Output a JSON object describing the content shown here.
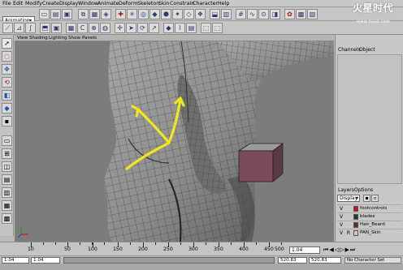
{
  "menubar": {
    "items": [
      "File",
      "Edit",
      "Modify",
      "Create",
      "Display",
      "Window",
      "Animate",
      "Deform",
      "Skeleton",
      "Skin",
      "Constrain",
      "Character",
      "Help"
    ]
  },
  "shelf": {
    "mode": "Animation"
  },
  "viewport": {
    "menu": [
      "View",
      "Shading",
      "Lighting",
      "Show",
      "Panels"
    ]
  },
  "channel_box": {
    "tabs": [
      "Channels",
      "Object"
    ]
  },
  "layers": {
    "tabs": [
      "Layers",
      "Options"
    ],
    "display_label": "Display",
    "rows": [
      {
        "v": "V",
        "r": "",
        "name": "footcontrols",
        "color": "#c01414"
      },
      {
        "v": "V",
        "r": "",
        "name": "blades",
        "color": "#303030"
      },
      {
        "v": "V",
        "r": "",
        "name": "Hair_Beard",
        "color": "#6a2a1a"
      },
      {
        "v": "V",
        "r": "R",
        "name": "PAN_Skin",
        "color": "#e2bfc2"
      }
    ]
  },
  "timeline": {
    "labels": [
      "10",
      "50",
      "100",
      "150",
      "200",
      "250",
      "300",
      "350",
      "400",
      "450",
      "500"
    ],
    "current_frame": "1.04"
  },
  "range": {
    "start": "1.04",
    "inner_start": "1.04",
    "inner_end": "520.83",
    "end": "520.83",
    "character_set": "No Character Set"
  },
  "watermark": {
    "title": "火星时代",
    "url": "www.hxsd.com"
  },
  "colors": {
    "arrow": "#f2e61c",
    "cube_face": "#7a4a5a",
    "selection_red": "#c01414"
  }
}
